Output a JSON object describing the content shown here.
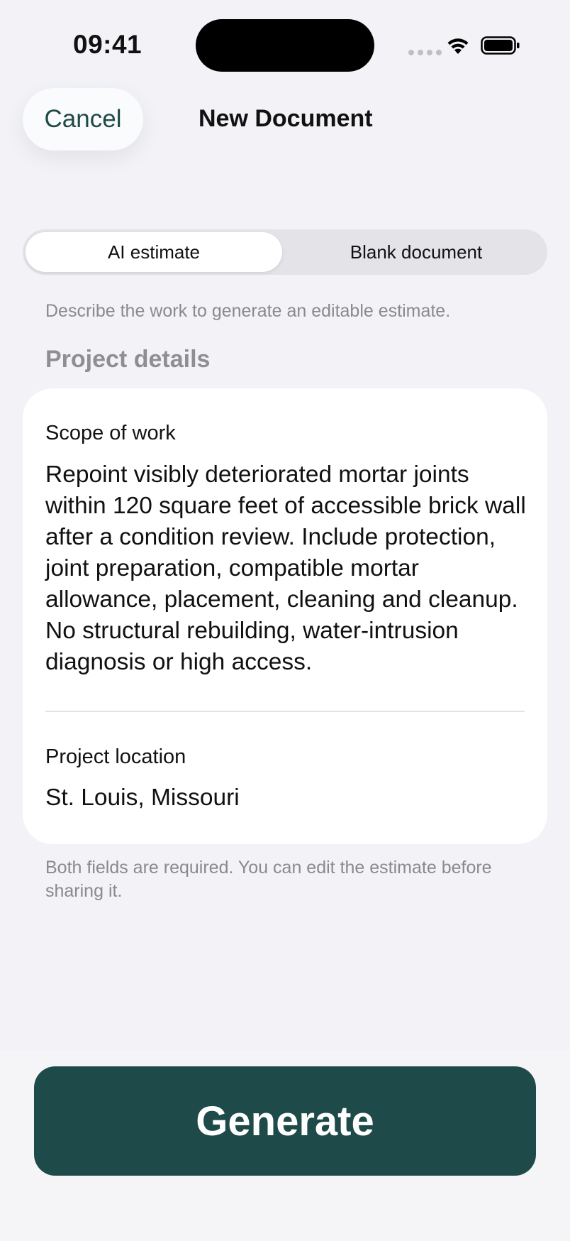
{
  "status_bar": {
    "time": "09:41"
  },
  "nav": {
    "cancel_label": "Cancel",
    "title": "New Document"
  },
  "segmented": {
    "options": [
      "AI estimate",
      "Blank document"
    ],
    "selected": "AI estimate"
  },
  "hint": "Describe the work to generate an editable estimate.",
  "section_title": "Project details",
  "form": {
    "scope_label": "Scope of work",
    "scope_value": "Repoint visibly deteriorated mortar joints within 120 square feet of accessible brick wall after a condition review. Include protection, joint preparation, compatible mortar allowance, placement, cleaning and cleanup. No structural rebuilding, water-intrusion diagnosis or high access.",
    "location_label": "Project location",
    "location_value": "St. Louis, Missouri"
  },
  "footnote": "Both fields are required. You can edit the estimate before sharing it.",
  "generate_label": "Generate",
  "colors": {
    "accent": "#1f4a4a",
    "background": "#f2f2f7",
    "secondary_text": "#8a8a8e"
  },
  "icons": [
    "signal-dots-icon",
    "wifi-icon",
    "battery-icon"
  ]
}
